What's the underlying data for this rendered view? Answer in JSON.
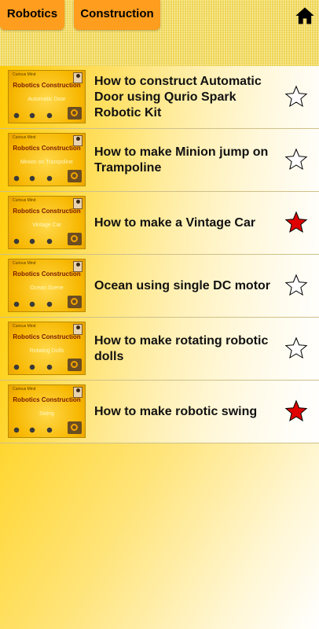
{
  "header": {
    "tabs": [
      {
        "label": "Robotics"
      },
      {
        "label": "Construction"
      }
    ],
    "home_icon": "home-icon"
  },
  "thumbnail_brand": "Robotics Construction",
  "thumbnail_tagline": "Curious Mind",
  "items": [
    {
      "title": "How to construct Automatic Door using Qurio Spark Robotic Kit",
      "thumb_label": "Automatic Door",
      "favorite": false
    },
    {
      "title": "How to make Minion jump on Trampoline",
      "thumb_label": "Minion on Trampoline",
      "favorite": false
    },
    {
      "title": "How to make a Vintage Car",
      "thumb_label": "Vintage Car",
      "favorite": true
    },
    {
      "title": "Ocean using single DC motor",
      "thumb_label": "Ocean Scene",
      "favorite": false
    },
    {
      "title": "How to make rotating robotic dolls",
      "thumb_label": "Rotating Dolls",
      "favorite": false
    },
    {
      "title": "How to make robotic swing",
      "thumb_label": "Swing",
      "favorite": true
    }
  ],
  "colors": {
    "tab": "#ff9d1e",
    "star_on": "#e00000",
    "star_off": "#ffffff"
  }
}
